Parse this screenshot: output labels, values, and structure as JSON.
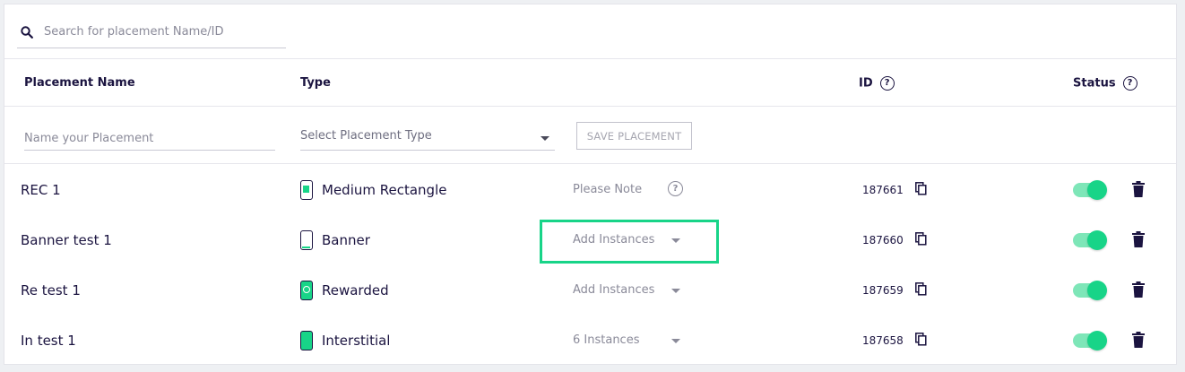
{
  "search": {
    "placeholder": "Search for placement Name/ID"
  },
  "headers": {
    "placement_name": "Placement Name",
    "type": "Type",
    "id": "ID",
    "status": "Status"
  },
  "new_placement": {
    "name_placeholder": "Name your Placement",
    "type_placeholder": "Select Placement Type",
    "save_label": "SAVE PLACEMENT"
  },
  "rows": [
    {
      "name": "REC 1",
      "type": "Medium Rectangle",
      "type_icon": "medium-rectangle-icon",
      "instances": "Please Note",
      "instances_kind": "note",
      "id": "187661",
      "status_on": true
    },
    {
      "name": "Banner test 1",
      "type": "Banner",
      "type_icon": "banner-icon",
      "instances": "Add Instances",
      "instances_kind": "dropdown",
      "id": "187660",
      "status_on": true
    },
    {
      "name": "Re test 1",
      "type": "Rewarded",
      "type_icon": "rewarded-icon",
      "instances": "Add Instances",
      "instances_kind": "dropdown",
      "id": "187659",
      "status_on": true
    },
    {
      "name": "In test 1",
      "type": "Interstitial",
      "type_icon": "interstitial-icon",
      "instances": "6 Instances",
      "instances_kind": "dropdown",
      "id": "187658",
      "status_on": true
    }
  ],
  "colors": {
    "accent": "#18d488",
    "toggle_track": "#7ee6b8",
    "text_primary": "#1b1440",
    "text_muted": "#8a8a99"
  }
}
